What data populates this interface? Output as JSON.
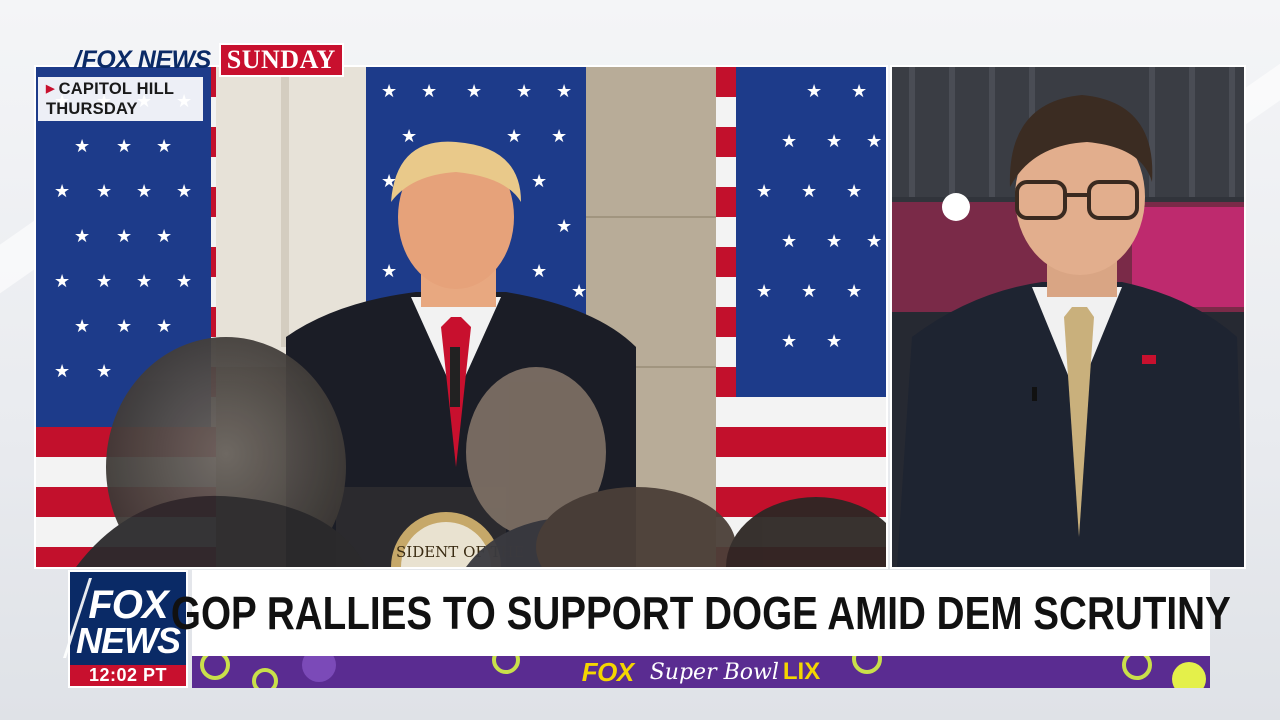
{
  "network": {
    "logo_text": "FOX NEWS",
    "show_badge": "SUNDAY"
  },
  "location_tag": {
    "line1": "CAPITOL HILL",
    "line2": "THURSDAY"
  },
  "video": {
    "left_podium_seal_text": "SIDENT OF THE",
    "left_scene": "speaker at podium with american flags",
    "right_scene": "guest in suit with glasses"
  },
  "lower_third": {
    "logo_line1": "FOX",
    "logo_line2": "NEWS",
    "time": "12:02 PT",
    "headline": "GOP RALLIES TO SUPPORT DOGE AMID DEM SCRUTINY"
  },
  "ticker": {
    "brand": "FOX",
    "event": "Super Bowl",
    "event_numeral": "LIX"
  },
  "colors": {
    "fox_navy": "#0a2a66",
    "fox_red": "#c8102e",
    "ticker_purple": "#5a2c91",
    "ticker_yellow": "#f4d600"
  }
}
